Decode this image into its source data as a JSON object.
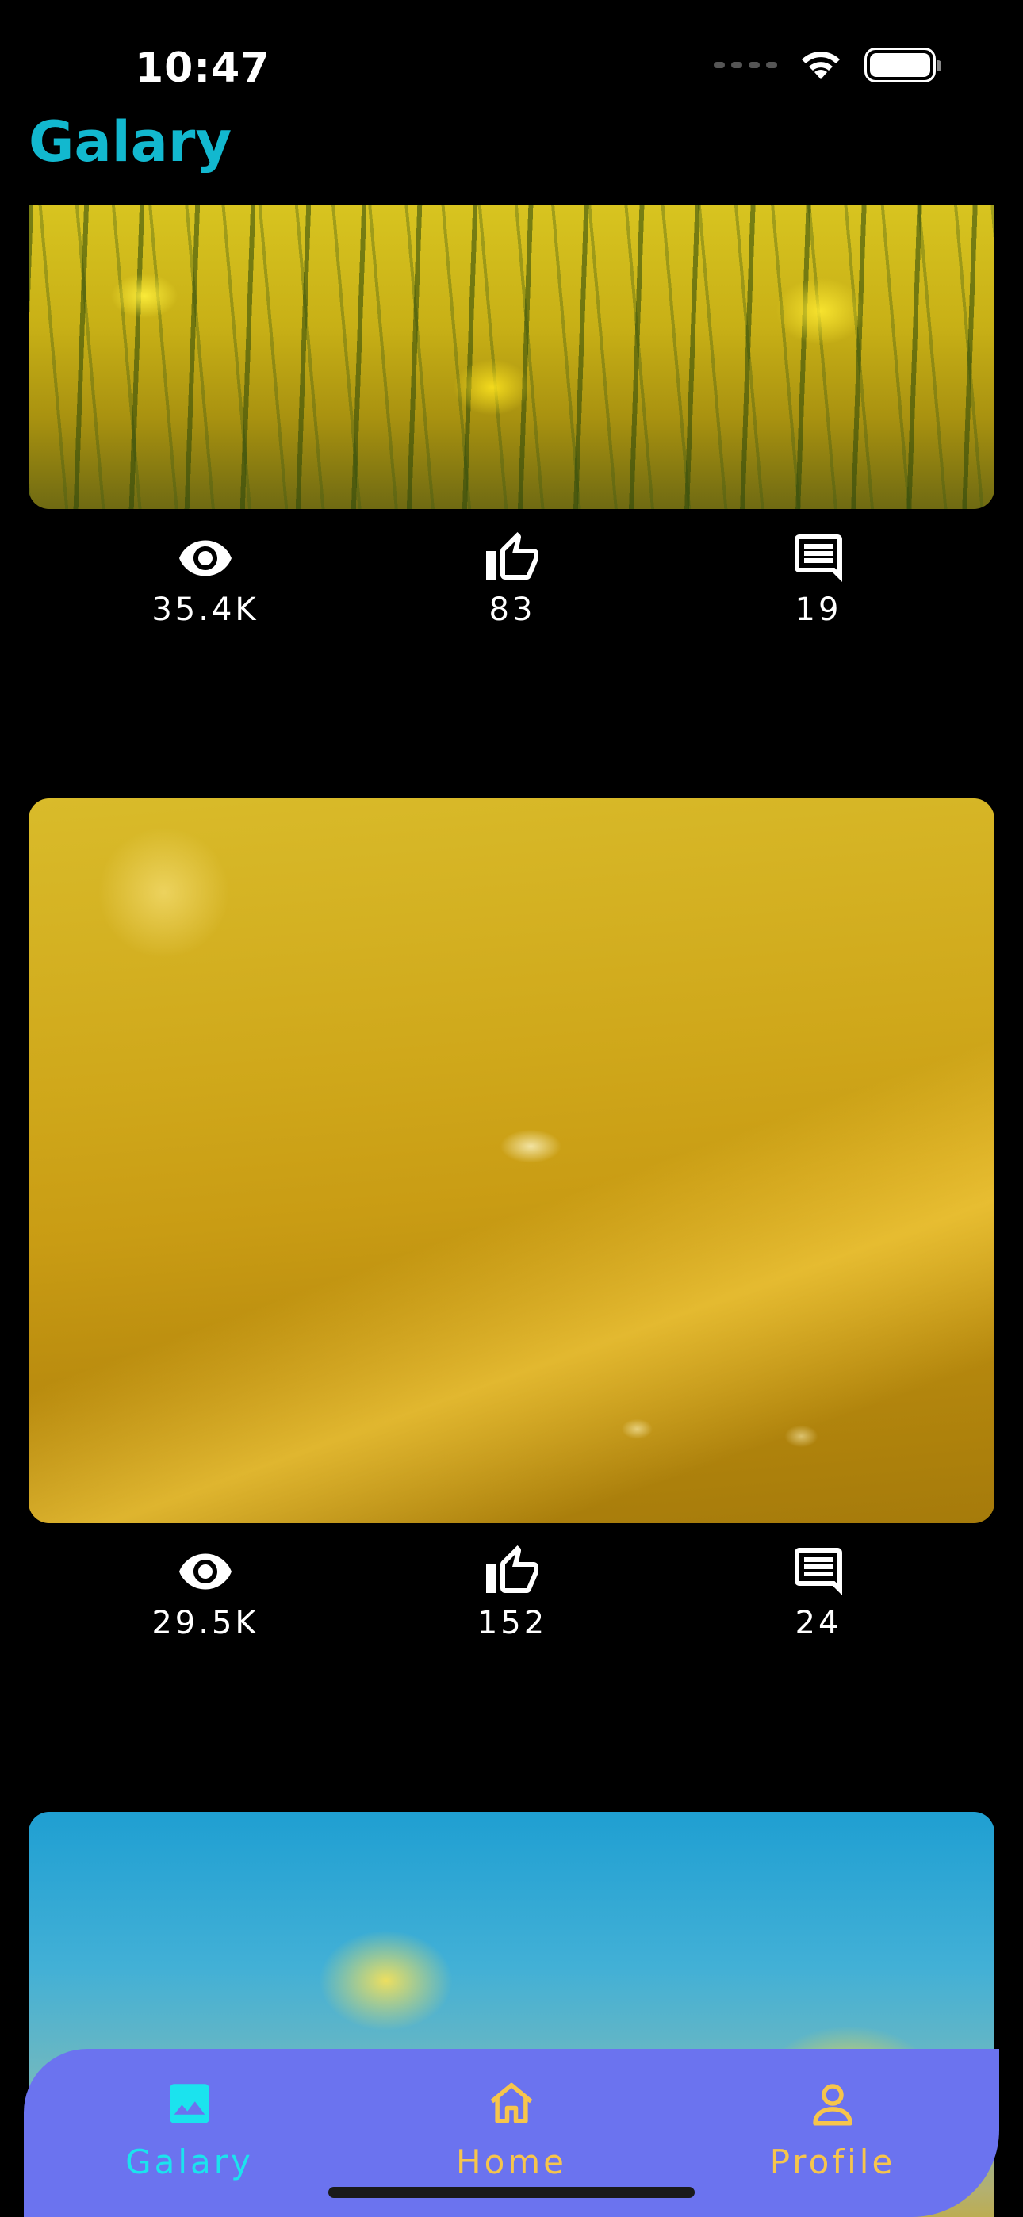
{
  "status_bar": {
    "time": "10:47"
  },
  "header": {
    "title": "Galary"
  },
  "posts": [
    {
      "views": "35.4K",
      "likes": "83",
      "comments": "19"
    },
    {
      "views": "29.5K",
      "likes": "152",
      "comments": "24"
    }
  ],
  "icons": {
    "views": "eye-icon",
    "likes": "thumb-up-icon",
    "comments": "comment-icon"
  },
  "bottom_nav": {
    "items": [
      {
        "label": "Galary",
        "icon": "image-icon",
        "active": true
      },
      {
        "label": "Home",
        "icon": "home-icon",
        "active": false
      },
      {
        "label": "Profile",
        "icon": "person-icon",
        "active": false
      }
    ]
  },
  "colors": {
    "title": "#12b8cf",
    "nav_background": "#6b73ef",
    "nav_active": "#1be3ee",
    "nav_inactive": "#f6c54c"
  }
}
